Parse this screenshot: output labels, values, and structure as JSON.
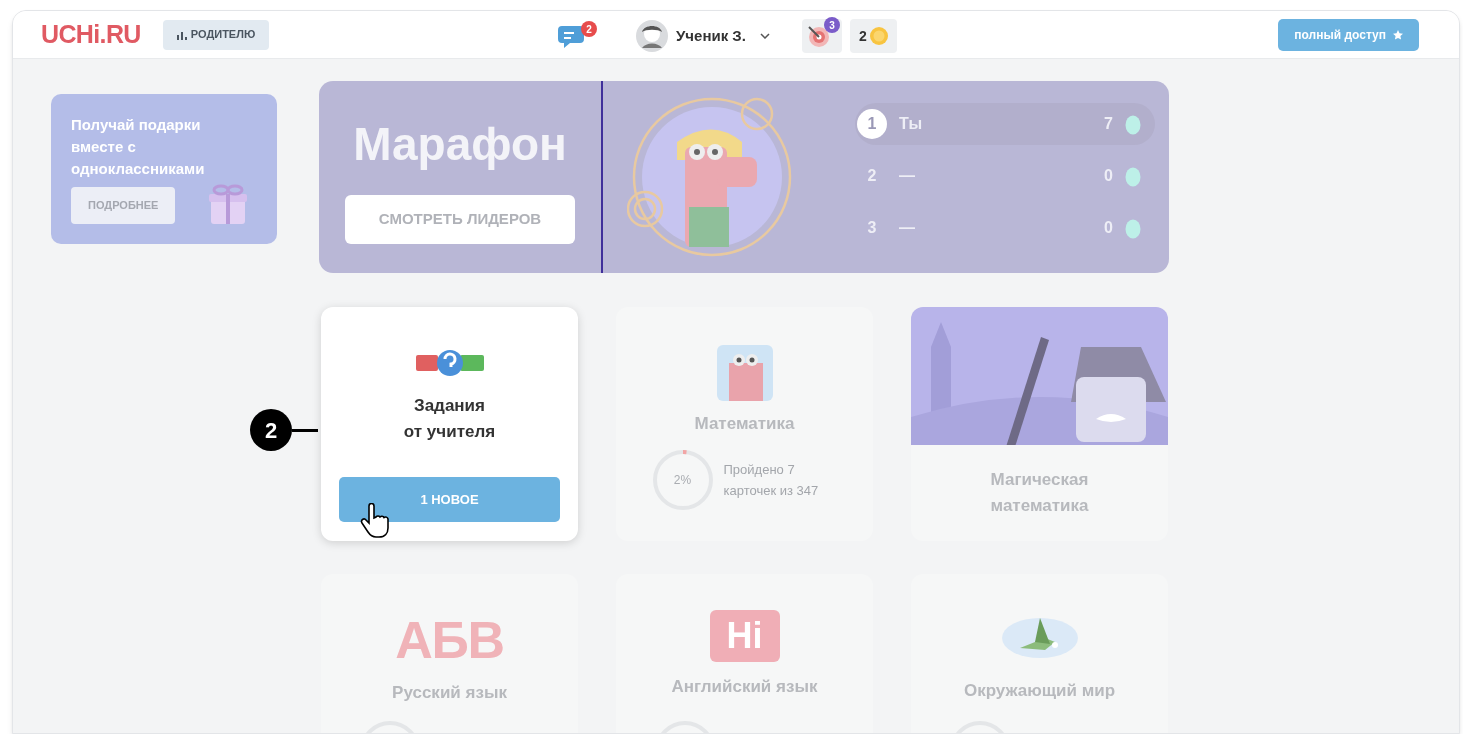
{
  "header": {
    "logo": "UCHi.RU",
    "parent_button": "РОДИТЕЛЮ",
    "chat_badge": "2",
    "user_name": "Ученик З.",
    "goals_badge": "3",
    "coins": "2",
    "access_button": "полный доступ"
  },
  "promo": {
    "text": "Получай подарки вместе с одноклассниками",
    "button": "ПОДРОБНЕЕ"
  },
  "marathon": {
    "title": "Марафон",
    "button": "СМОТРЕТЬ ЛИДЕРОВ",
    "leaders": [
      {
        "rank": "1",
        "name": "Ты",
        "score": "7",
        "highlighted": true
      },
      {
        "rank": "2",
        "name": "—",
        "score": "0",
        "highlighted": false
      },
      {
        "rank": "3",
        "name": "—",
        "score": "0",
        "highlighted": false
      }
    ]
  },
  "cards": [
    {
      "kind": "task",
      "title": "Задания\nот учителя",
      "button": "1 НОВОЕ",
      "dimmed": false
    },
    {
      "kind": "progress",
      "title": "Математика",
      "ring_label": "2%",
      "level": 0.02,
      "progress_text": "Пройдено 7 карточек из 347",
      "dimmed": true
    },
    {
      "kind": "image",
      "title": "Магическая\nматематика",
      "dimmed": true
    },
    {
      "kind": "russian",
      "title": "Русский язык",
      "icon_text": "АБВ",
      "dimmed": true
    },
    {
      "kind": "english",
      "title": "Английский язык",
      "icon_text": "Hi",
      "dimmed": true
    },
    {
      "kind": "world",
      "title": "Окружающий мир",
      "dimmed": true
    }
  ],
  "callout": {
    "label": "2"
  }
}
